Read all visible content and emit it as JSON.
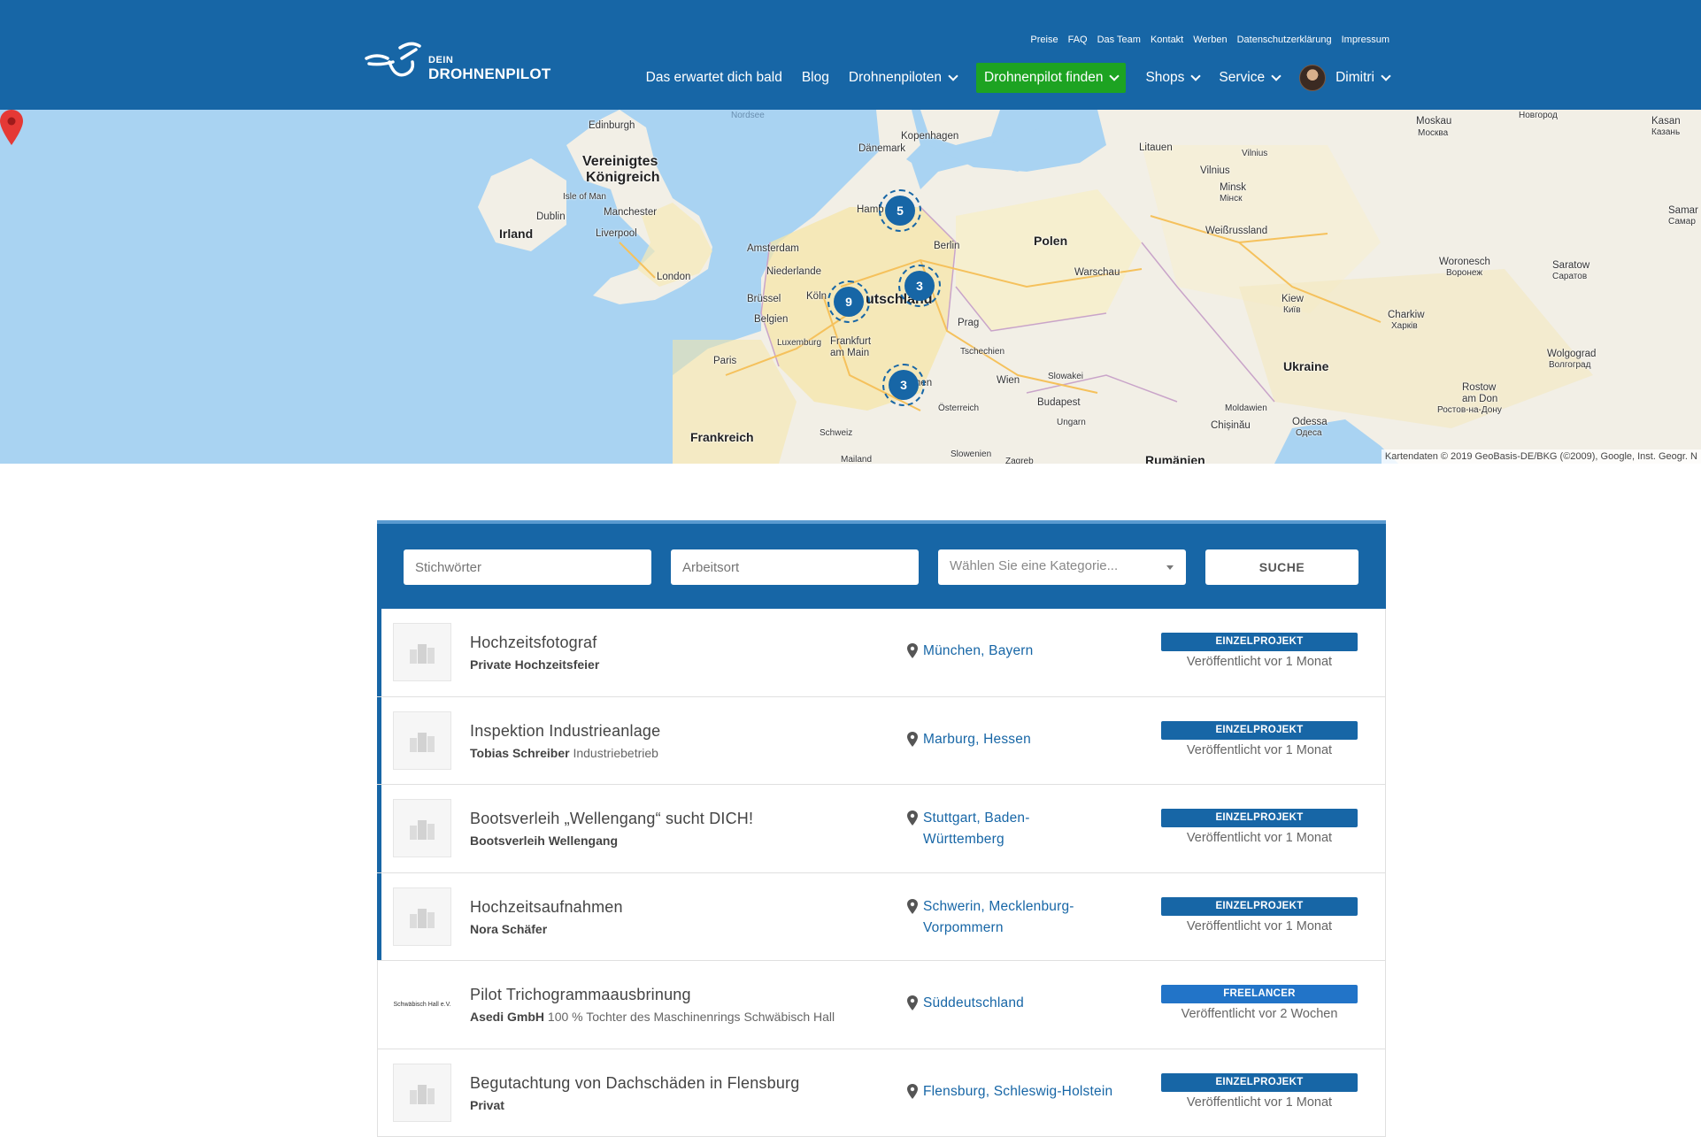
{
  "brand": {
    "line1": "DEIN",
    "line2": "DROHNENPILOT"
  },
  "top_links": [
    "Preise",
    "FAQ",
    "Das Team",
    "Kontakt",
    "Werben",
    "Datenschutzerklärung",
    "Impressum"
  ],
  "nav": {
    "items": [
      {
        "label": "Das erwartet dich bald",
        "dropdown": false
      },
      {
        "label": "Blog",
        "dropdown": false
      },
      {
        "label": "Drohnenpiloten",
        "dropdown": true
      },
      {
        "label": "Drohnenpilot finden",
        "dropdown": true,
        "active": true
      },
      {
        "label": "Shops",
        "dropdown": true
      },
      {
        "label": "Service",
        "dropdown": true
      }
    ],
    "user": {
      "name": "Dimitri"
    }
  },
  "map": {
    "labels": {
      "nordsee": "Nordsee",
      "edinburgh": "Edinburgh",
      "vk1": "Vereinigtes",
      "vk2": "Königreich",
      "isle_of_man": "Isle of Man",
      "dublin": "Dublin",
      "manchester": "Manchester",
      "liverpool": "Liverpool",
      "irland": "Irland",
      "london": "London",
      "daenemark": "Dänemark",
      "kopenhagen": "Kopenhagen",
      "hamb": "Hamb",
      "amsterdam": "Amsterdam",
      "niederlande": "Niederlande",
      "bruessel": "Brüssel",
      "belgien": "Belgien",
      "koeln": "Köln",
      "deutschland_frag": "utschland",
      "luxemburg": "Luxemburg",
      "frankfurt1": "Frankfurt",
      "frankfurt2": "am Main",
      "paris": "Paris",
      "frankreich": "Frankreich",
      "schweiz": "Schweiz",
      "mailand": "Mailand",
      "berlin": "Berlin",
      "polen": "Polen",
      "warschau": "Warschau",
      "prag": "Prag",
      "tschechien": "Tschechien",
      "wien": "Wien",
      "oesterreich": "Österreich",
      "slowakei": "Slowakei",
      "budapest": "Budapest",
      "ungarn": "Ungarn",
      "slowenien": "Slowenien",
      "zagreb": "Zagreb",
      "muenchen_frag": "hen",
      "litauen": "Litauen",
      "vilnius1": "Vilnius",
      "vilnius2": "Vilnius",
      "minsk1": "Minsk",
      "minsk2": "Мінск",
      "weissrussland": "Weißrussland",
      "moskau1": "Moskau",
      "moskau2": "Москва",
      "nowgorod": "Новгород",
      "kasan1": "Kasan",
      "kasan2": "Казань",
      "samara1": "Samar",
      "samara2": "Самар",
      "woronesch1": "Woronesch",
      "woronesch2": "Воронеж",
      "saratow1": "Saratow",
      "saratow2": "Саратов",
      "kiew1": "Kiew",
      "kiew2": "Київ",
      "charkiw1": "Charkiw",
      "charkiw2": "Харків",
      "ukraine": "Ukraine",
      "wolgograd1": "Wolgograd",
      "wolgograd2": "Волгоград",
      "rostow1": "Rostow",
      "rostow2": "am Don",
      "rostow3": "Ростов-на-Дону",
      "moldawien": "Moldawien",
      "chisinau": "Chișinău",
      "odessa1": "Odessa",
      "odessa2": "Одеса",
      "rumaenien": "Rumänien"
    },
    "clusters": [
      "5",
      "3",
      "9",
      "3"
    ],
    "attribution": "Kartendaten © 2019 GeoBasis-DE/BKG (©2009), Google, Inst. Geogr. N"
  },
  "search": {
    "keywords_placeholder": "Stichwörter",
    "location_placeholder": "Arbeitsort",
    "category_placeholder": "Wählen Sie eine Kategorie...",
    "button_label": "SUCHE"
  },
  "jobs": [
    {
      "title": "Hochzeitsfotograf",
      "company": "Private Hochzeitsfeier",
      "company_note": "",
      "location": "München, Bayern",
      "type": "EINZELPROJEKT",
      "posted": "Veröffentlicht vor 1 Monat",
      "featured": true
    },
    {
      "title": "Inspektion Industrieanlage",
      "company": "Tobias Schreiber",
      "company_note": "Industriebetrieb",
      "location": "Marburg, Hessen",
      "type": "EINZELPROJEKT",
      "posted": "Veröffentlicht vor 1 Monat",
      "featured": true
    },
    {
      "title": "Bootsverleih „Wellengang“ sucht DICH!",
      "company": "Bootsverleih Wellengang",
      "company_note": "",
      "location": "Stuttgart, Baden-Württemberg",
      "type": "EINZELPROJEKT",
      "posted": "Veröffentlicht vor 1 Monat",
      "featured": true
    },
    {
      "title": "Hochzeitsaufnahmen",
      "company": "Nora Schäfer",
      "company_note": "",
      "location": "Schwerin, Mecklenburg-Vorpommern",
      "type": "EINZELPROJEKT",
      "posted": "Veröffentlicht vor 1 Monat",
      "featured": true
    },
    {
      "title": "Pilot Trichogrammaausbrinung",
      "company": "Asedi GmbH",
      "company_note": "100 % Tochter des Maschinenrings Schwäbisch Hall",
      "location": "Süddeutschland",
      "type": "FREELANCER",
      "posted": "Veröffentlicht vor 2 Wochen",
      "featured": false,
      "logo_text": "Schwäbisch Hall e.V."
    },
    {
      "title": "Begutachtung von Dachschäden in Flensburg",
      "company": "Privat",
      "company_note": "",
      "location": "Flensburg, Schleswig-Holstein",
      "type": "EINZELPROJEKT",
      "posted": "Veröffentlicht vor 1 Monat",
      "featured": false
    }
  ],
  "colors": {
    "brand_blue": "#1766a6",
    "active_green": "#1da322"
  },
  "icons": {
    "location": "map-pin-icon",
    "logo_placeholder": "building-icon"
  }
}
